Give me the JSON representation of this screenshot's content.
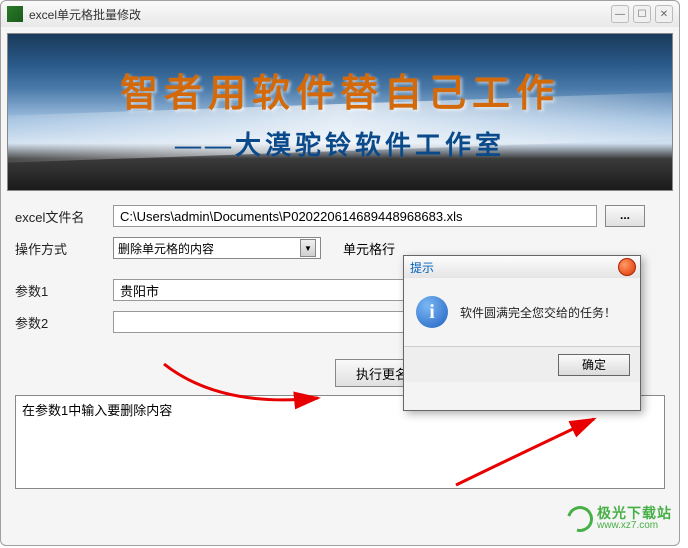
{
  "window": {
    "title": "excel单元格批量修改"
  },
  "banner": {
    "main": "智者用软件替自己工作",
    "sub": "——大漠驼铃软件工作室"
  },
  "fields": {
    "file_label": "excel文件名",
    "file_value": "C:\\Users\\admin\\Documents\\P020220614689448968683.xls",
    "browse": "...",
    "mode_label": "操作方式",
    "mode_value": "删除单元格的内容",
    "cell_label": "单元格行",
    "param1_label": "参数1",
    "param1_value": "贵阳市",
    "param2_label": "参数2",
    "param2_value": "",
    "exec": "执行更名",
    "log": "在参数1中输入要删除内容"
  },
  "dialog": {
    "title": "提示",
    "info_glyph": "i",
    "message": "软件圆满完全您交给的任务！",
    "ok": "确定"
  },
  "watermark": {
    "main": "极光下载站",
    "sub": "www.xz7.com"
  }
}
